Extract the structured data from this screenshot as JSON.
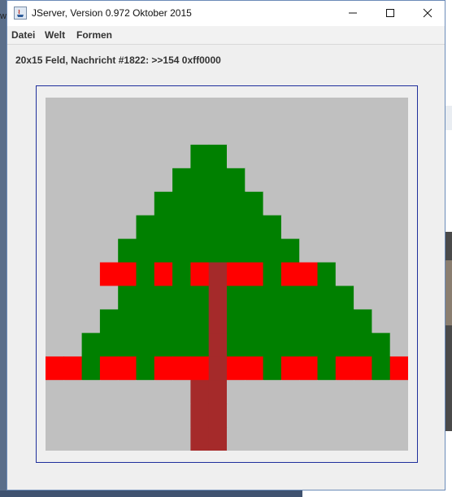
{
  "window": {
    "title": "JServer, Version 0.972 Oktober 2015"
  },
  "menu": {
    "items": [
      "Datei",
      "Welt",
      "Formen"
    ]
  },
  "status": {
    "text": "20x15 Feld, Nachricht #1822: >>154 0xff0000"
  },
  "colors": {
    "background": "#c0c0c0",
    "green": "#008000",
    "red": "#ff0000",
    "trunk": "#a52a2a",
    "border": "#1f2f9c"
  },
  "grid": {
    "cols": 20,
    "rows": 15,
    "legend": {
      "0": "gray",
      "1": "green",
      "2": "red",
      "3": "trunk"
    },
    "cells": [
      "00000000000000000000",
      "00000000000000000000",
      "00000000110000000000",
      "00000001111000000000",
      "00000011111100000000",
      "00000111111110000000",
      "00001111111111000000",
      "00022121232212210000",
      "00001111131111111000",
      "00011111131111111100",
      "00111111131111111110",
      "22122122232212212212",
      "00000000330000000000",
      "00000000330000000000",
      "00000000330000000000"
    ]
  },
  "icons": {
    "app": "java-app-icon",
    "minimize": "minimize-icon",
    "maximize": "maximize-icon",
    "close": "close-icon"
  }
}
